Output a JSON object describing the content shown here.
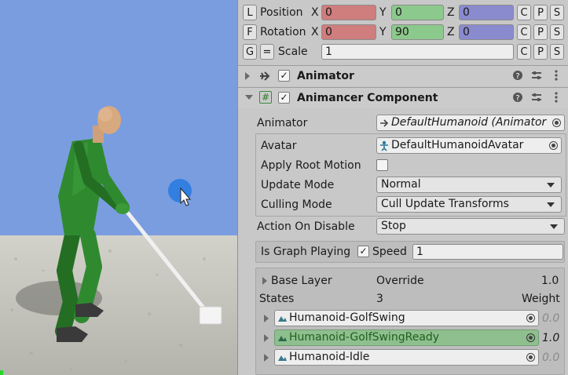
{
  "transform": {
    "position": {
      "label": "Position",
      "btn": "L",
      "x": "0",
      "y": "0",
      "z": "0"
    },
    "rotation": {
      "label": "Rotation",
      "btn": "F",
      "x": "0",
      "y": "90",
      "z": "0"
    },
    "scale": {
      "label": "Scale",
      "btn": "G",
      "link": "=",
      "value": "1"
    },
    "axes": {
      "x": "X",
      "y": "Y",
      "z": "Z"
    },
    "copy": "C",
    "paste": "P",
    "reset": "S"
  },
  "animator": {
    "title": "Animator",
    "checked": "✓"
  },
  "animancer": {
    "title": "Animancer Component",
    "checked": "✓",
    "animator_label": "Animator",
    "animator_value": "DefaultHumanoid (Animator",
    "avatar_label": "Avatar",
    "avatar_value": "DefaultHumanoidAvatar",
    "apply_root_motion_label": "Apply Root Motion",
    "update_mode_label": "Update Mode",
    "update_mode_value": "Normal",
    "culling_mode_label": "Culling Mode",
    "culling_mode_value": "Cull Update Transforms",
    "action_on_disable_label": "Action On Disable",
    "action_on_disable_value": "Stop",
    "is_graph_playing_label": "Is Graph Playing",
    "is_graph_playing_checked": "✓",
    "speed_label": "Speed",
    "speed_value": "1"
  },
  "layer": {
    "name": "Base Layer",
    "mode": "Override",
    "weight": "1.0",
    "states_label": "States",
    "states_count": "3",
    "weight_label": "Weight",
    "states": [
      {
        "name": "Humanoid-GolfSwing",
        "weight": "0.0"
      },
      {
        "name": "Humanoid-GolfSwingReady",
        "weight": "1.0"
      },
      {
        "name": "Humanoid-Idle",
        "weight": "0.0"
      }
    ]
  },
  "colors": {
    "sky": "#7a9ddf",
    "ground": "#c9c9c1",
    "suit": "#2f8a2f",
    "active_state": "#8fbf8f",
    "cursor": "#2f7de0"
  }
}
